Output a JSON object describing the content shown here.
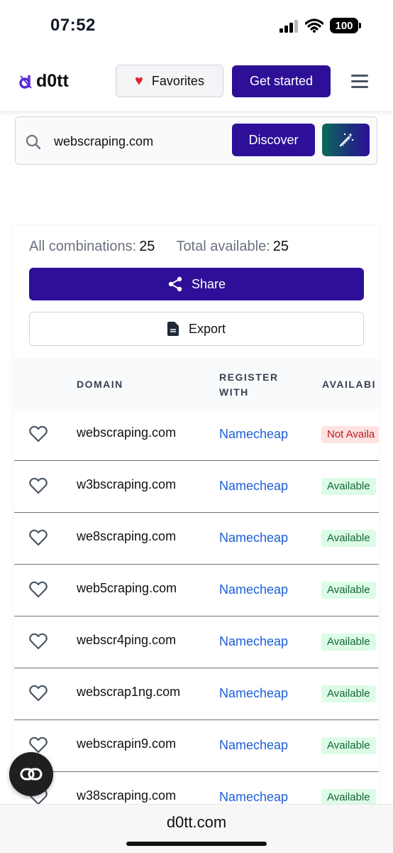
{
  "status_bar": {
    "time": "07:52",
    "battery": "100"
  },
  "header": {
    "logo_text": "d0tt",
    "favorites_label": "Favorites",
    "get_started_label": "Get started"
  },
  "search": {
    "value": "webscraping.com",
    "discover_label": "Discover"
  },
  "results": {
    "all_combinations_label": "All combinations:",
    "all_combinations_value": "25",
    "total_available_label": "Total available:",
    "total_available_value": "25",
    "share_label": "Share",
    "export_label": "Export",
    "columns": {
      "domain": "DOMAIN",
      "register_line1": "REGISTER",
      "register_line2": "WITH",
      "availability": "AVAILABI"
    },
    "rows": [
      {
        "domain": "webscraping.com",
        "registrar": "Namecheap",
        "status": "Not Availa",
        "available": false
      },
      {
        "domain": "w3bscraping.com",
        "registrar": "Namecheap",
        "status": "Available",
        "available": true
      },
      {
        "domain": "we8scraping.com",
        "registrar": "Namecheap",
        "status": "Available",
        "available": true
      },
      {
        "domain": "web5craping.com",
        "registrar": "Namecheap",
        "status": "Available",
        "available": true
      },
      {
        "domain": "webscr4ping.com",
        "registrar": "Namecheap",
        "status": "Available",
        "available": true
      },
      {
        "domain": "webscrap1ng.com",
        "registrar": "Namecheap",
        "status": "Available",
        "available": true
      },
      {
        "domain": "webscrapin9.com",
        "registrar": "Namecheap",
        "status": "Available",
        "available": true
      },
      {
        "domain": "w38scraping.com",
        "registrar": "Namecheap",
        "status": "Available",
        "available": true
      }
    ]
  },
  "browser": {
    "url": "d0tt.com"
  },
  "colors": {
    "primary": "#2d1097",
    "link": "#1d5fd6",
    "available_bg": "#dcfce7",
    "unavailable_bg": "#fee2e2"
  }
}
